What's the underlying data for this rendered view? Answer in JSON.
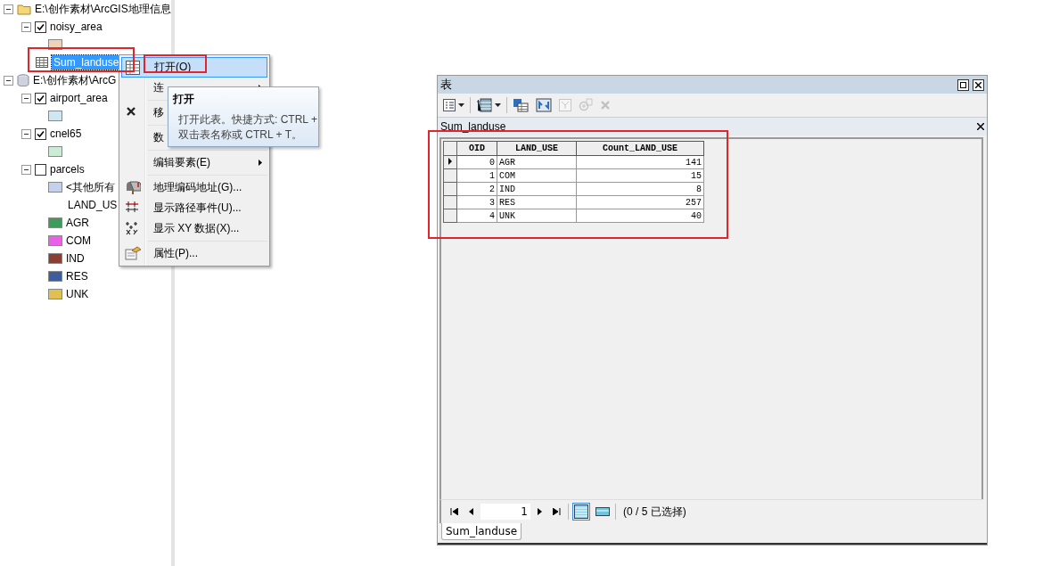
{
  "tree": [
    {
      "kind": "folder",
      "label": "E:\\创作素材\\ArcGIS地理信息",
      "expanded": true,
      "children": [
        {
          "kind": "layer",
          "label": "noisy_area",
          "checked": true,
          "expanded": true,
          "children": [
            {
              "kind": "swatch",
              "color": "#f0d2b9"
            }
          ]
        },
        {
          "kind": "table",
          "label": "Sum_landuse",
          "selected": true
        }
      ]
    },
    {
      "kind": "database",
      "label": "E:\\创作素材\\ArcG",
      "expanded": true,
      "children": [
        {
          "kind": "layer",
          "label": "airport_area",
          "checked": true,
          "expanded": true,
          "children": [
            {
              "kind": "swatch",
              "color": "#cfe6f3"
            }
          ]
        },
        {
          "kind": "layer",
          "label": "cnel65",
          "checked": true,
          "expanded": true,
          "children": [
            {
              "kind": "swatch",
              "color": "#c9ecd5"
            }
          ]
        },
        {
          "kind": "layer",
          "label": "parcels",
          "checked": false,
          "expanded": true,
          "children": [
            {
              "kind": "swatch",
              "color": "#c3d0ee",
              "label": "<其他所有"
            },
            {
              "kind": "heading",
              "label": "LAND_US"
            },
            {
              "kind": "swatch",
              "color": "#3f9a5c",
              "label": "AGR"
            },
            {
              "kind": "swatch",
              "color": "#ea5fe5",
              "label": "COM"
            },
            {
              "kind": "swatch",
              "color": "#8a3f33",
              "label": "IND"
            },
            {
              "kind": "swatch",
              "color": "#3f5d9a",
              "label": "RES"
            },
            {
              "kind": "swatch",
              "color": "#e0c050",
              "label": "UNK"
            }
          ]
        }
      ]
    }
  ],
  "context_menu": [
    {
      "kind": "open",
      "label": "打开(O)",
      "selected": true
    },
    {
      "kind": "join",
      "label": "连",
      "submenu": true,
      "selected": false
    },
    {
      "kind": "separator"
    },
    {
      "kind": "remove",
      "label": "移",
      "selected": false
    },
    {
      "kind": "separator"
    },
    {
      "kind": "data",
      "label": "数",
      "selected": false
    },
    {
      "kind": "separator"
    },
    {
      "kind": "edit",
      "label": "编辑要素(E)",
      "submenu": true,
      "selected": false
    },
    {
      "kind": "separator"
    },
    {
      "kind": "geocode",
      "label": "地理编码地址(G)...",
      "selected": false
    },
    {
      "kind": "route",
      "label": "显示路径事件(U)...",
      "selected": false
    },
    {
      "kind": "xy",
      "label": "显示 XY 数据(X)...",
      "selected": false
    },
    {
      "kind": "separator"
    },
    {
      "kind": "properties",
      "label": "属性(P)...",
      "selected": false
    }
  ],
  "tooltip": {
    "title": "打开",
    "text": "打开此表。快捷方式: CTRL +\n双击表名称或 CTRL + T。"
  },
  "table_window": {
    "title": "表",
    "toolbar": [
      {
        "kind": "options",
        "dropdown": true,
        "disabled": false
      },
      {
        "kind": "related",
        "dropdown": true,
        "disabled": false
      },
      {
        "kind": "select",
        "disabled": false
      },
      {
        "kind": "switch",
        "disabled": false
      },
      {
        "kind": "clear",
        "disabled": true
      },
      {
        "kind": "zoom",
        "disabled": true
      },
      {
        "kind": "delete",
        "disabled": true
      }
    ],
    "tab_title": "Sum_landuse",
    "columns": [
      "OID",
      "LAND_USE",
      "Count_LAND_USE"
    ],
    "rows": [
      {
        "cells": [
          "0",
          "AGR",
          "141"
        ],
        "current": true
      },
      {
        "cells": [
          "1",
          "COM",
          "15"
        ],
        "current": false
      },
      {
        "cells": [
          "2",
          "IND",
          "8"
        ],
        "current": false
      },
      {
        "cells": [
          "3",
          "RES",
          "257"
        ],
        "current": false
      },
      {
        "cells": [
          "4",
          "UNK",
          "40"
        ],
        "current": false
      }
    ],
    "record": "1",
    "views": [
      {
        "kind": "all",
        "selected": true
      },
      {
        "kind": "selected",
        "selected": false
      }
    ],
    "status": "(0 / 5 已选择)",
    "bottom_tab": "Sum_landuse"
  }
}
